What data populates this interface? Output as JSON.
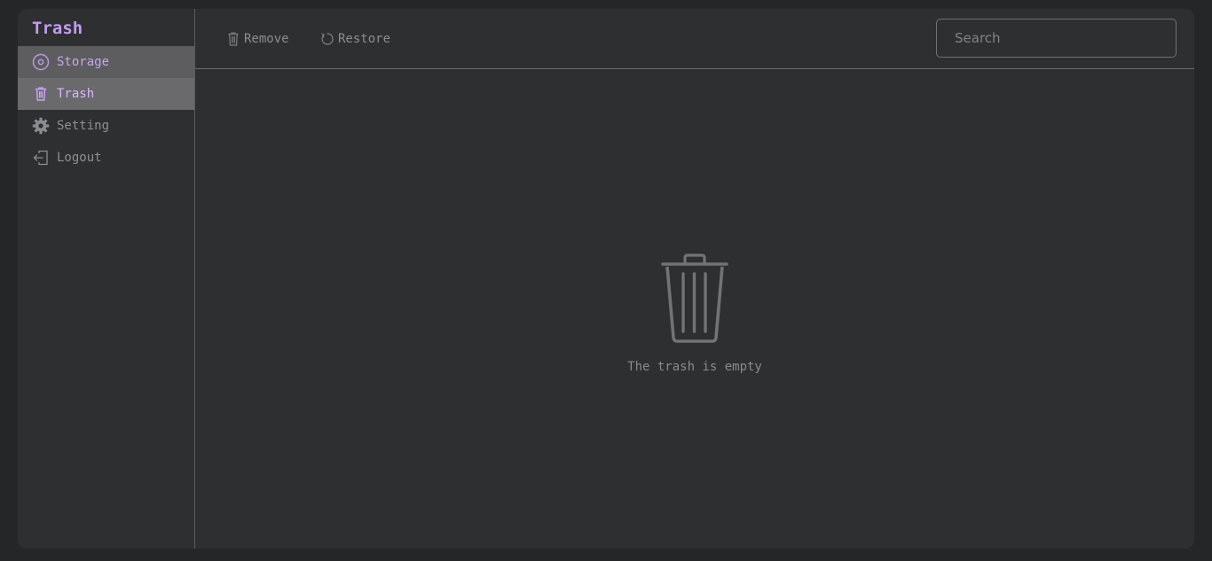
{
  "app": {
    "title": "Trash",
    "accent": "#c39bf0"
  },
  "sidebar": {
    "items": [
      {
        "label": "Storage",
        "icon": "disc-icon",
        "state": "hover"
      },
      {
        "label": "Trash",
        "icon": "trash-icon",
        "state": "active"
      },
      {
        "label": "Setting",
        "icon": "gear-icon",
        "state": "normal"
      },
      {
        "label": "Logout",
        "icon": "logout-icon",
        "state": "normal"
      }
    ]
  },
  "toolbar": {
    "remove_label": "Remove",
    "remove_icon": "trash-icon",
    "restore_label": "Restore",
    "restore_icon": "restore-icon"
  },
  "search": {
    "placeholder": "Search",
    "value": ""
  },
  "main": {
    "empty_icon": "trash-can-icon",
    "empty_message": "The trash is empty"
  }
}
